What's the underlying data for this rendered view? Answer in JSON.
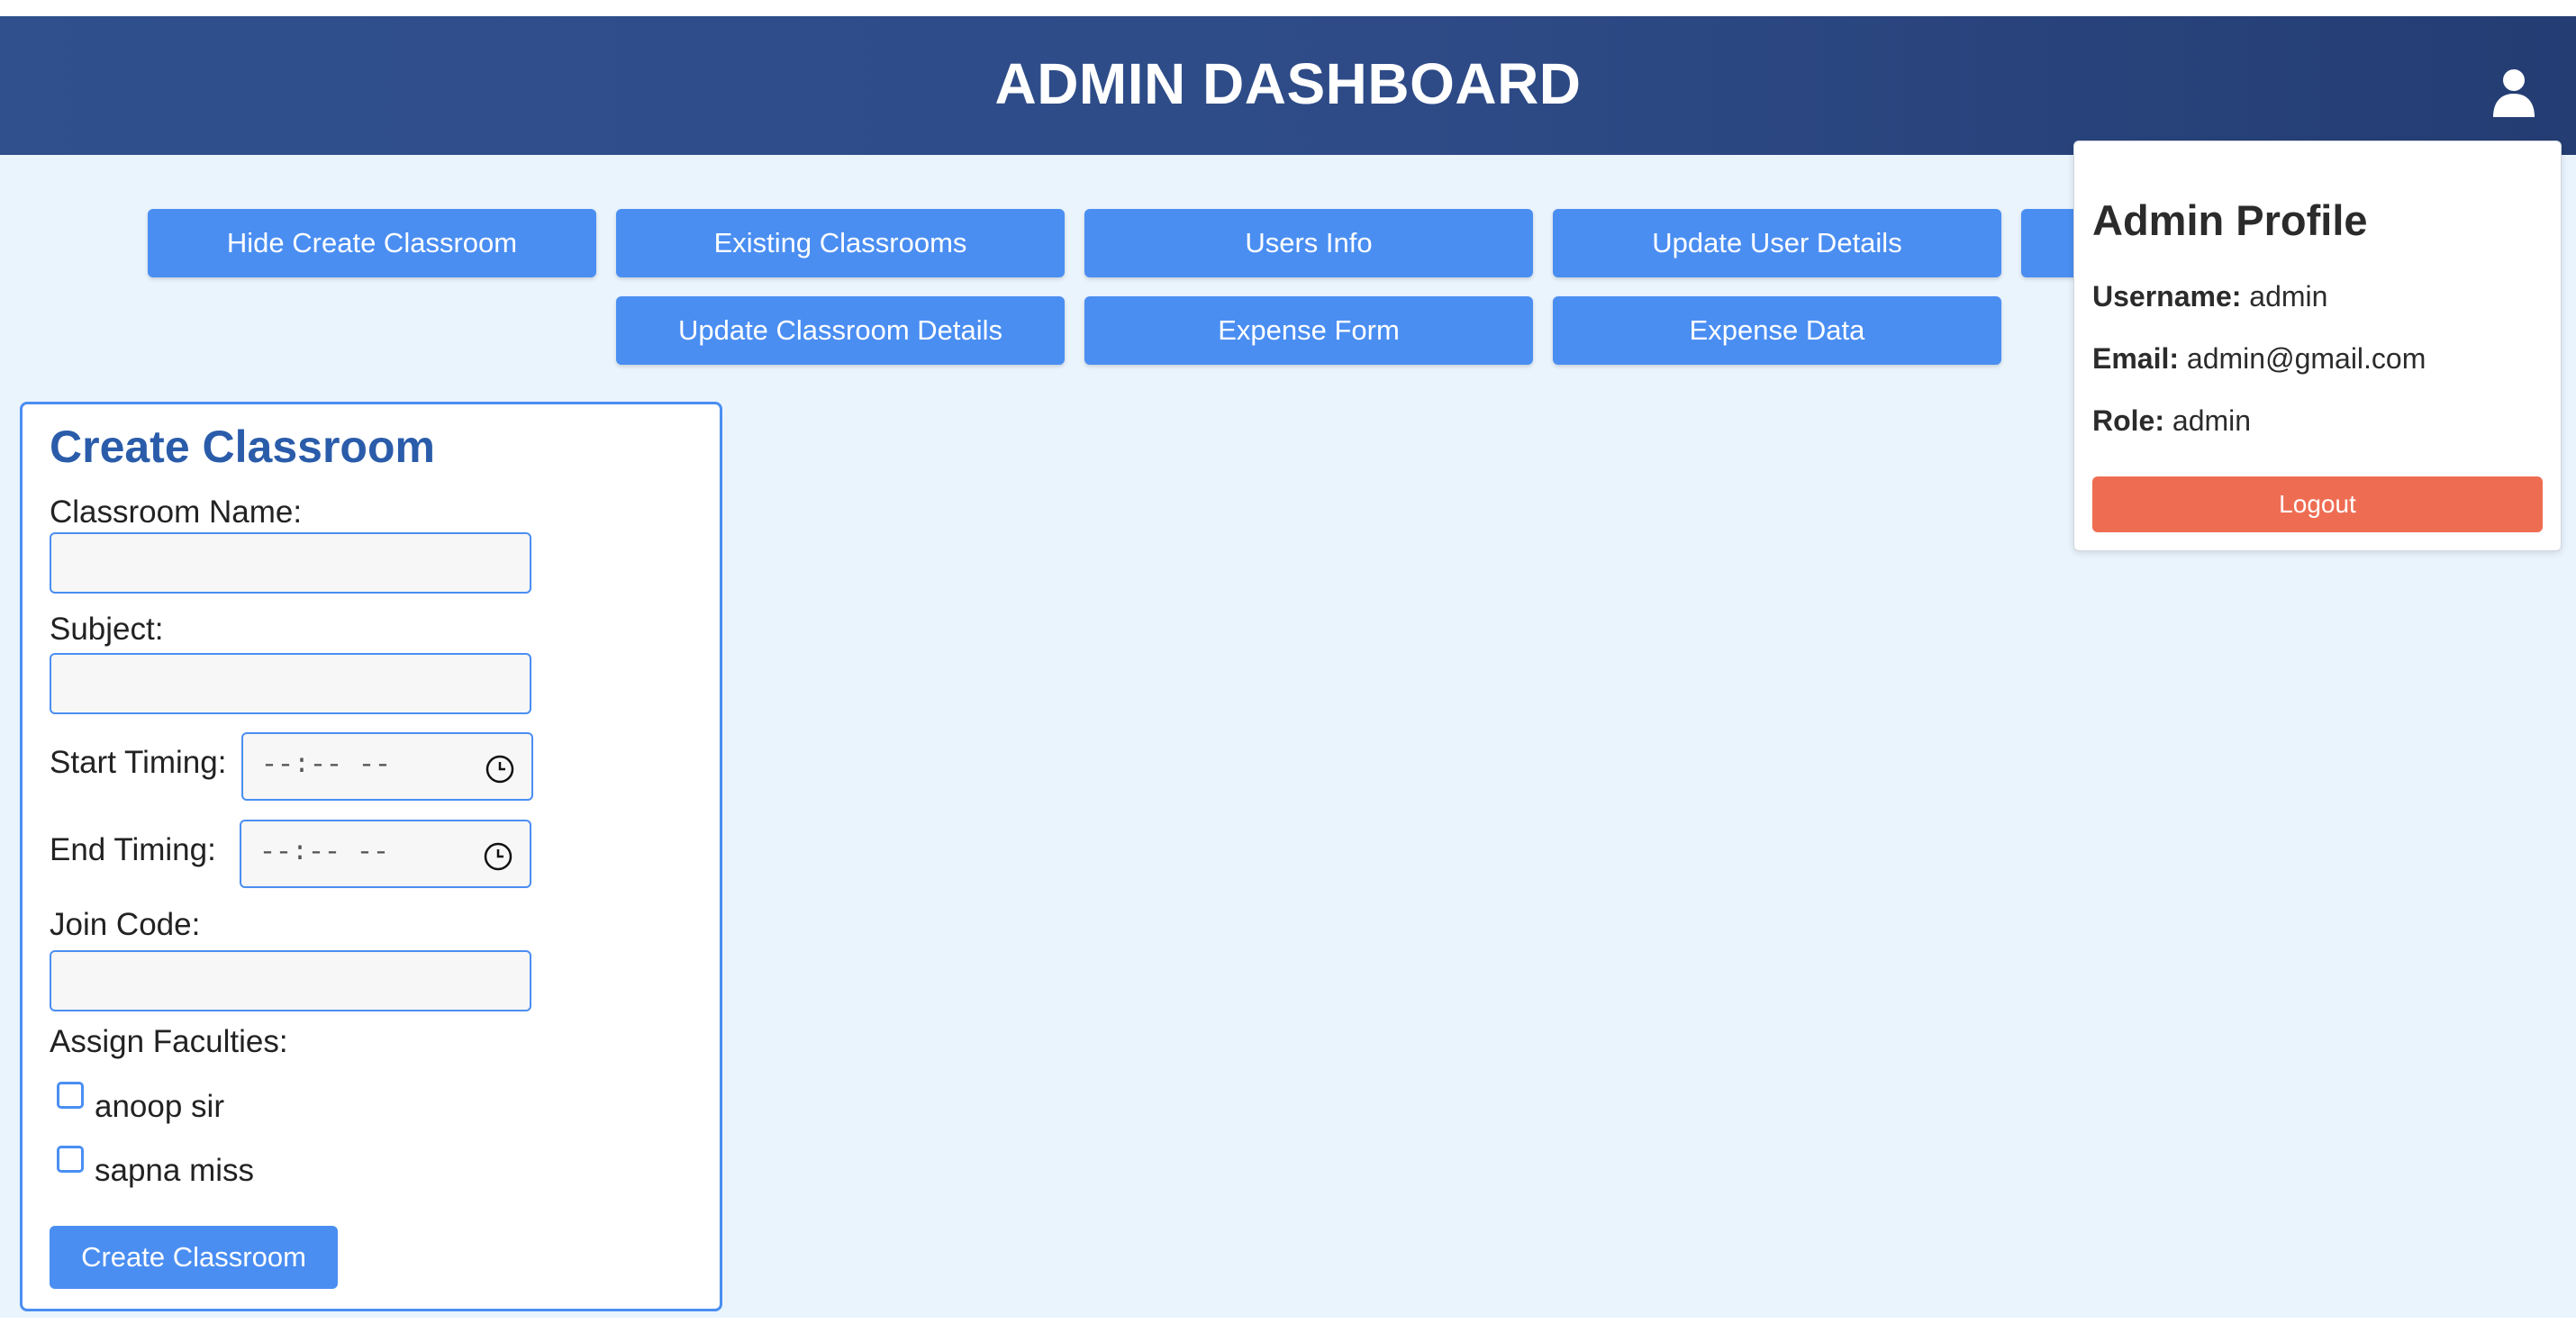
{
  "header": {
    "title": "ADMIN DASHBOARD",
    "user_icon": "user-icon"
  },
  "nav": {
    "buttons": [
      "Hide Create Classroom",
      "Existing Classrooms",
      "Users Info",
      "Update User Details",
      "Update Classroom Details",
      "Expense Form",
      "Expense Data"
    ]
  },
  "create_classroom": {
    "title": "Create Classroom",
    "classroom_name_label": "Classroom Name:",
    "classroom_name_value": "",
    "subject_label": "Subject:",
    "subject_value": "",
    "start_timing_label": "Start Timing:",
    "start_timing_value": "--:-- --",
    "end_timing_label": "End Timing:",
    "end_timing_value": "--:-- --",
    "join_code_label": "Join Code:",
    "join_code_value": "",
    "assign_faculties_label": "Assign Faculties:",
    "faculties": [
      {
        "name": "anoop sir",
        "checked": false
      },
      {
        "name": "sapna miss",
        "checked": false
      }
    ],
    "submit_label": "Create Classroom"
  },
  "profile": {
    "title": "Admin Profile",
    "username_label": "Username:",
    "username": "admin",
    "email_label": "Email:",
    "email": "admin@gmail.com",
    "role_label": "Role:",
    "role": "admin",
    "logout_label": "Logout"
  },
  "colors": {
    "header_bg": "#2e4b87",
    "page_bg": "#eaf4fd",
    "accent": "#4a8ef2",
    "title_blue": "#2a5caa",
    "logout": "#ee6d52"
  }
}
